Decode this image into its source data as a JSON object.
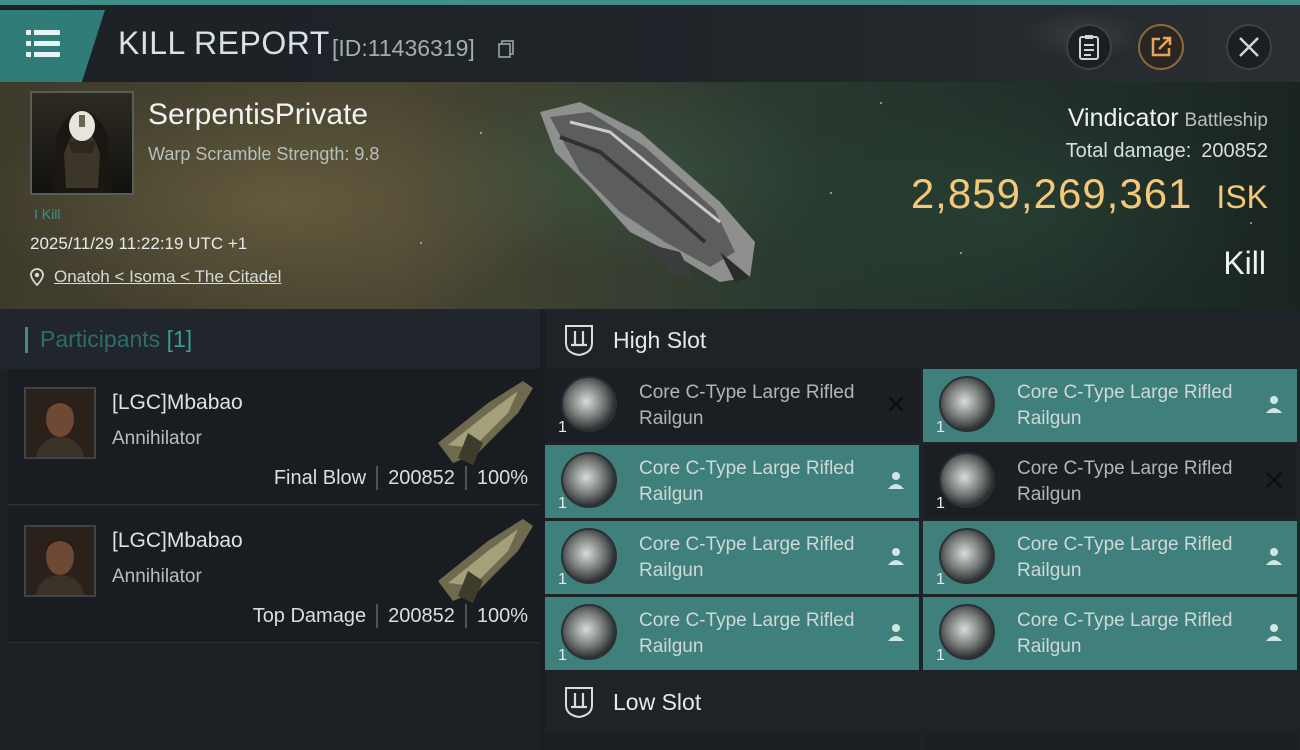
{
  "header": {
    "title": "KILL REPORT",
    "report_id": "[ID:11436319]"
  },
  "victim": {
    "name": "SerpentisPrivate",
    "warp_scramble": "Warp Scramble Strength: 9.8",
    "kill_count": "I Kill",
    "timestamp": "2025/11/29 11:22:19 UTC +1",
    "location": "Onatoh < Isoma < The Citadel"
  },
  "ship": {
    "name": "Vindicator",
    "class": "Battleship",
    "damage_label": "Total damage:",
    "damage_value": "200852",
    "isk_value": "2,859,269,361",
    "isk_unit": "ISK",
    "result": "Kill"
  },
  "participants": {
    "title": "Participants",
    "count": "[1]",
    "items": [
      {
        "name": "[LGC]Mbabao",
        "ship": "Annihilator",
        "role": "Final Blow",
        "damage": "200852",
        "percent": "100%"
      },
      {
        "name": "[LGC]Mbabao",
        "ship": "Annihilator",
        "role": "Top Damage",
        "damage": "200852",
        "percent": "100%"
      }
    ]
  },
  "fitting": {
    "high_slot_title": "High Slot",
    "low_slot_title": "Low Slot",
    "modules": [
      {
        "name": "Core C-Type Large Rifled Railgun",
        "qty": "1",
        "status": "destroyed"
      },
      {
        "name": "Core C-Type Large Rifled Railgun",
        "qty": "1",
        "status": "dropped"
      },
      {
        "name": "Core C-Type Large Rifled Railgun",
        "qty": "1",
        "status": "dropped"
      },
      {
        "name": "Core C-Type Large Rifled Railgun",
        "qty": "1",
        "status": "destroyed"
      },
      {
        "name": "Core C-Type Large Rifled Railgun",
        "qty": "1",
        "status": "dropped"
      },
      {
        "name": "Core C-Type Large Rifled Railgun",
        "qty": "1",
        "status": "dropped"
      },
      {
        "name": "Core C-Type Large Rifled Railgun",
        "qty": "1",
        "status": "dropped"
      },
      {
        "name": "Core C-Type Large Rifled Railgun",
        "qty": "1",
        "status": "dropped"
      }
    ]
  },
  "colors": {
    "accent_teal": "#3f807c",
    "isk_gold": "#f3c878"
  },
  "icons": [
    "menu-icon",
    "copy-icon",
    "clipboard-icon",
    "share-icon",
    "close-icon",
    "location-pin-icon",
    "high-slot-icon",
    "low-slot-icon",
    "person-icon",
    "x-icon"
  ]
}
